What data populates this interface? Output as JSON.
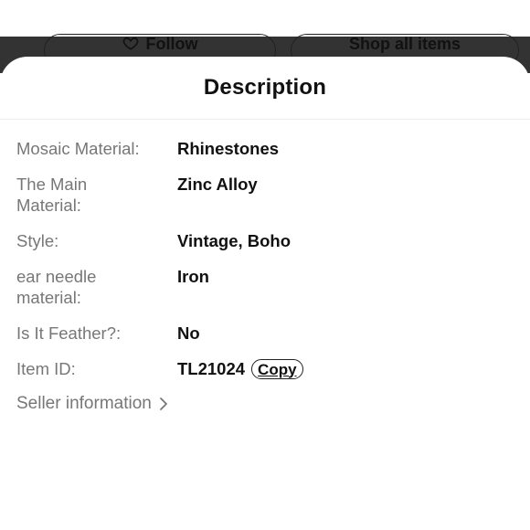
{
  "background": {
    "follow_label": "Follow",
    "shop_label": "Shop all items"
  },
  "sheet": {
    "title": "Description",
    "rows": [
      {
        "label": "Mosaic Material:",
        "value": "Rhinestones"
      },
      {
        "label": "The Main\nMaterial:",
        "value": "Zinc Alloy"
      },
      {
        "label": "Style:",
        "value": "Vintage, Boho"
      },
      {
        "label": "ear needle\nmaterial:",
        "value": "Iron"
      },
      {
        "label": "Is It Feather?:",
        "value": "No"
      },
      {
        "label": "Item ID:",
        "value": "TL21024"
      }
    ],
    "copy_label": "Copy",
    "seller_label": "Seller information"
  },
  "colors": {
    "label": "#777777",
    "value": "#111111",
    "backdrop_bar": "#333333"
  },
  "icons": {
    "follow": "heart-outline-icon",
    "seller": "chevron-right-icon"
  }
}
